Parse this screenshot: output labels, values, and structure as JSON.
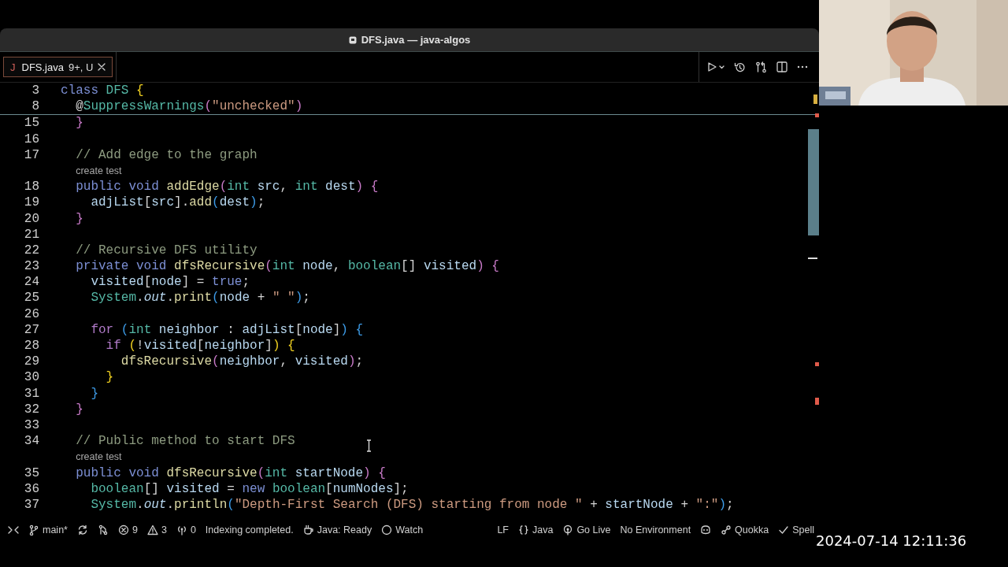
{
  "window": {
    "title": "DFS.java — java-algos"
  },
  "tabs": [
    {
      "icon": "J",
      "label": "DFS.java",
      "badge": "9+, U",
      "selected": true
    }
  ],
  "editor": {
    "sticky": [
      {
        "number": "3",
        "tokens": [
          {
            "kind": "kw",
            "text": "class "
          },
          {
            "kind": "type",
            "text": "DFS"
          },
          {
            "kind": "b1",
            "text": " {"
          }
        ]
      },
      {
        "number": "8",
        "tokens": [
          {
            "kind": "plain",
            "text": "  @"
          },
          {
            "kind": "type",
            "text": "SuppressWarnings"
          },
          {
            "kind": "b2",
            "text": "("
          },
          {
            "kind": "str",
            "text": "\"unchecked\""
          },
          {
            "kind": "b2",
            "text": ")"
          }
        ]
      }
    ],
    "lines": [
      {
        "kind": "code",
        "number": "15",
        "tokens": [
          {
            "kind": "b2",
            "text": "  }"
          }
        ]
      },
      {
        "kind": "code",
        "number": "16"
      },
      {
        "kind": "code",
        "number": "17",
        "tokens": [
          {
            "kind": "cmt",
            "text": "  // Add edge to the graph"
          }
        ]
      },
      {
        "kind": "lens",
        "text": "  create test"
      },
      {
        "kind": "code",
        "number": "18",
        "tokens": [
          {
            "kind": "kw",
            "text": "  public void "
          },
          {
            "kind": "fn",
            "text": "addEdge"
          },
          {
            "kind": "b2",
            "text": "("
          },
          {
            "kind": "type",
            "text": "int "
          },
          {
            "kind": "var",
            "text": "src"
          },
          {
            "kind": "plain",
            "text": ", "
          },
          {
            "kind": "type",
            "text": "int "
          },
          {
            "kind": "var",
            "text": "dest"
          },
          {
            "kind": "b2",
            "text": ")"
          },
          {
            "kind": "b2",
            "text": " {"
          }
        ]
      },
      {
        "kind": "code",
        "number": "19",
        "tokens": [
          {
            "kind": "var",
            "text": "    adjList"
          },
          {
            "kind": "plain",
            "text": "["
          },
          {
            "kind": "var",
            "text": "src"
          },
          {
            "kind": "plain",
            "text": "]."
          },
          {
            "kind": "fn",
            "text": "add"
          },
          {
            "kind": "b3",
            "text": "("
          },
          {
            "kind": "var",
            "text": "dest"
          },
          {
            "kind": "b3",
            "text": ")"
          },
          {
            "kind": "plain",
            "text": ";"
          }
        ]
      },
      {
        "kind": "code",
        "number": "20",
        "tokens": [
          {
            "kind": "b2",
            "text": "  }"
          }
        ]
      },
      {
        "kind": "code",
        "number": "21"
      },
      {
        "kind": "code",
        "number": "22",
        "tokens": [
          {
            "kind": "cmt",
            "text": "  // Recursive DFS utility"
          }
        ]
      },
      {
        "kind": "code",
        "number": "23",
        "tokens": [
          {
            "kind": "kw",
            "text": "  private void "
          },
          {
            "kind": "fn",
            "text": "dfsRecursive"
          },
          {
            "kind": "b2",
            "text": "("
          },
          {
            "kind": "type",
            "text": "int "
          },
          {
            "kind": "var",
            "text": "node"
          },
          {
            "kind": "plain",
            "text": ", "
          },
          {
            "kind": "type",
            "text": "boolean"
          },
          {
            "kind": "plain",
            "text": "[] "
          },
          {
            "kind": "var",
            "text": "visited"
          },
          {
            "kind": "b2",
            "text": ")"
          },
          {
            "kind": "b2",
            "text": " {"
          }
        ]
      },
      {
        "kind": "code",
        "number": "24",
        "tokens": [
          {
            "kind": "var",
            "text": "    visited"
          },
          {
            "kind": "plain",
            "text": "["
          },
          {
            "kind": "var",
            "text": "node"
          },
          {
            "kind": "plain",
            "text": "] = "
          },
          {
            "kind": "kw",
            "text": "true"
          },
          {
            "kind": "plain",
            "text": ";"
          }
        ]
      },
      {
        "kind": "code",
        "number": "25",
        "tokens": [
          {
            "kind": "type",
            "text": "    System"
          },
          {
            "kind": "plain",
            "text": "."
          },
          {
            "kind": "field",
            "text": "out"
          },
          {
            "kind": "plain",
            "text": "."
          },
          {
            "kind": "fn",
            "text": "print"
          },
          {
            "kind": "b3",
            "text": "("
          },
          {
            "kind": "var",
            "text": "node"
          },
          {
            "kind": "plain",
            "text": " + "
          },
          {
            "kind": "str",
            "text": "\" \""
          },
          {
            "kind": "b3",
            "text": ")"
          },
          {
            "kind": "plain",
            "text": ";"
          }
        ]
      },
      {
        "kind": "code",
        "number": "26"
      },
      {
        "kind": "code",
        "number": "27",
        "tokens": [
          {
            "kind": "ctl",
            "text": "    for "
          },
          {
            "kind": "b3",
            "text": "("
          },
          {
            "kind": "type",
            "text": "int "
          },
          {
            "kind": "var",
            "text": "neighbor"
          },
          {
            "kind": "plain",
            "text": " : "
          },
          {
            "kind": "var",
            "text": "adjList"
          },
          {
            "kind": "plain",
            "text": "["
          },
          {
            "kind": "var",
            "text": "node"
          },
          {
            "kind": "plain",
            "text": "]"
          },
          {
            "kind": "b3",
            "text": ")"
          },
          {
            "kind": "b3",
            "text": " {"
          }
        ]
      },
      {
        "kind": "code",
        "number": "28",
        "tokens": [
          {
            "kind": "ctl",
            "text": "      if "
          },
          {
            "kind": "b1",
            "text": "("
          },
          {
            "kind": "plain",
            "text": "!"
          },
          {
            "kind": "var",
            "text": "visited"
          },
          {
            "kind": "plain",
            "text": "["
          },
          {
            "kind": "var",
            "text": "neighbor"
          },
          {
            "kind": "plain",
            "text": "]"
          },
          {
            "kind": "b1",
            "text": ")"
          },
          {
            "kind": "b1",
            "text": " {"
          }
        ]
      },
      {
        "kind": "code",
        "number": "29",
        "tokens": [
          {
            "kind": "fn",
            "text": "        dfsRecursive"
          },
          {
            "kind": "b2",
            "text": "("
          },
          {
            "kind": "var",
            "text": "neighbor"
          },
          {
            "kind": "plain",
            "text": ", "
          },
          {
            "kind": "var",
            "text": "visited"
          },
          {
            "kind": "b2",
            "text": ")"
          },
          {
            "kind": "plain",
            "text": ";"
          }
        ]
      },
      {
        "kind": "code",
        "number": "30",
        "tokens": [
          {
            "kind": "b1",
            "text": "      }"
          }
        ]
      },
      {
        "kind": "code",
        "number": "31",
        "tokens": [
          {
            "kind": "b3",
            "text": "    }"
          }
        ]
      },
      {
        "kind": "code",
        "number": "32",
        "tokens": [
          {
            "kind": "b2",
            "text": "  }"
          }
        ]
      },
      {
        "kind": "code",
        "number": "33"
      },
      {
        "kind": "code",
        "number": "34",
        "tokens": [
          {
            "kind": "cmt",
            "text": "  // Public method to start DFS"
          }
        ]
      },
      {
        "kind": "lens",
        "text": "  create test"
      },
      {
        "kind": "code",
        "number": "35",
        "tokens": [
          {
            "kind": "kw",
            "text": "  public void "
          },
          {
            "kind": "fn",
            "text": "dfsRecursive"
          },
          {
            "kind": "b2",
            "text": "("
          },
          {
            "kind": "type",
            "text": "int "
          },
          {
            "kind": "var",
            "text": "startNode"
          },
          {
            "kind": "b2",
            "text": ")"
          },
          {
            "kind": "b2",
            "text": " {"
          }
        ]
      },
      {
        "kind": "code",
        "number": "36",
        "tokens": [
          {
            "kind": "type",
            "text": "    boolean"
          },
          {
            "kind": "plain",
            "text": "[] "
          },
          {
            "kind": "var",
            "text": "visited"
          },
          {
            "kind": "plain",
            "text": " = "
          },
          {
            "kind": "kw",
            "text": "new "
          },
          {
            "kind": "type",
            "text": "boolean"
          },
          {
            "kind": "plain",
            "text": "["
          },
          {
            "kind": "var",
            "text": "numNodes"
          },
          {
            "kind": "plain",
            "text": "];"
          }
        ]
      },
      {
        "kind": "code",
        "number": "37",
        "tokens": [
          {
            "kind": "type",
            "text": "    System"
          },
          {
            "kind": "plain",
            "text": "."
          },
          {
            "kind": "field",
            "text": "out"
          },
          {
            "kind": "plain",
            "text": "."
          },
          {
            "kind": "fn",
            "text": "println"
          },
          {
            "kind": "b3",
            "text": "("
          },
          {
            "kind": "str",
            "text": "\"Depth-First Search (DFS) starting from node \""
          },
          {
            "kind": "plain",
            "text": " + "
          },
          {
            "kind": "var",
            "text": "startNode"
          },
          {
            "kind": "plain",
            "text": " + "
          },
          {
            "kind": "str",
            "text": "\":\""
          },
          {
            "kind": "b3",
            "text": ")"
          },
          {
            "kind": "plain",
            "text": ";"
          }
        ]
      }
    ]
  },
  "status_bar": {
    "left": [
      {
        "kind": "remote"
      },
      {
        "kind": "branch",
        "text": "main*"
      },
      {
        "kind": "sync"
      },
      {
        "kind": "git"
      },
      {
        "kind": "error",
        "text": "9"
      },
      {
        "kind": "warning",
        "text": "3"
      },
      {
        "kind": "broadcast",
        "text": "0"
      },
      {
        "kind": "plain",
        "text": "Indexing completed."
      },
      {
        "kind": "coffee",
        "text": "Java: Ready"
      },
      {
        "kind": "circle",
        "text": "Watch"
      }
    ],
    "right": [
      {
        "kind": "plain",
        "text": "LF"
      },
      {
        "kind": "braces",
        "text": "Java"
      },
      {
        "kind": "live",
        "text": "Go Live"
      },
      {
        "kind": "plain",
        "text": "No Environment"
      },
      {
        "kind": "copilot"
      },
      {
        "kind": "quokka",
        "text": "Quokka"
      },
      {
        "kind": "check",
        "text": "Spell"
      }
    ]
  },
  "timestamp": "2024-07-14 12:11:36"
}
